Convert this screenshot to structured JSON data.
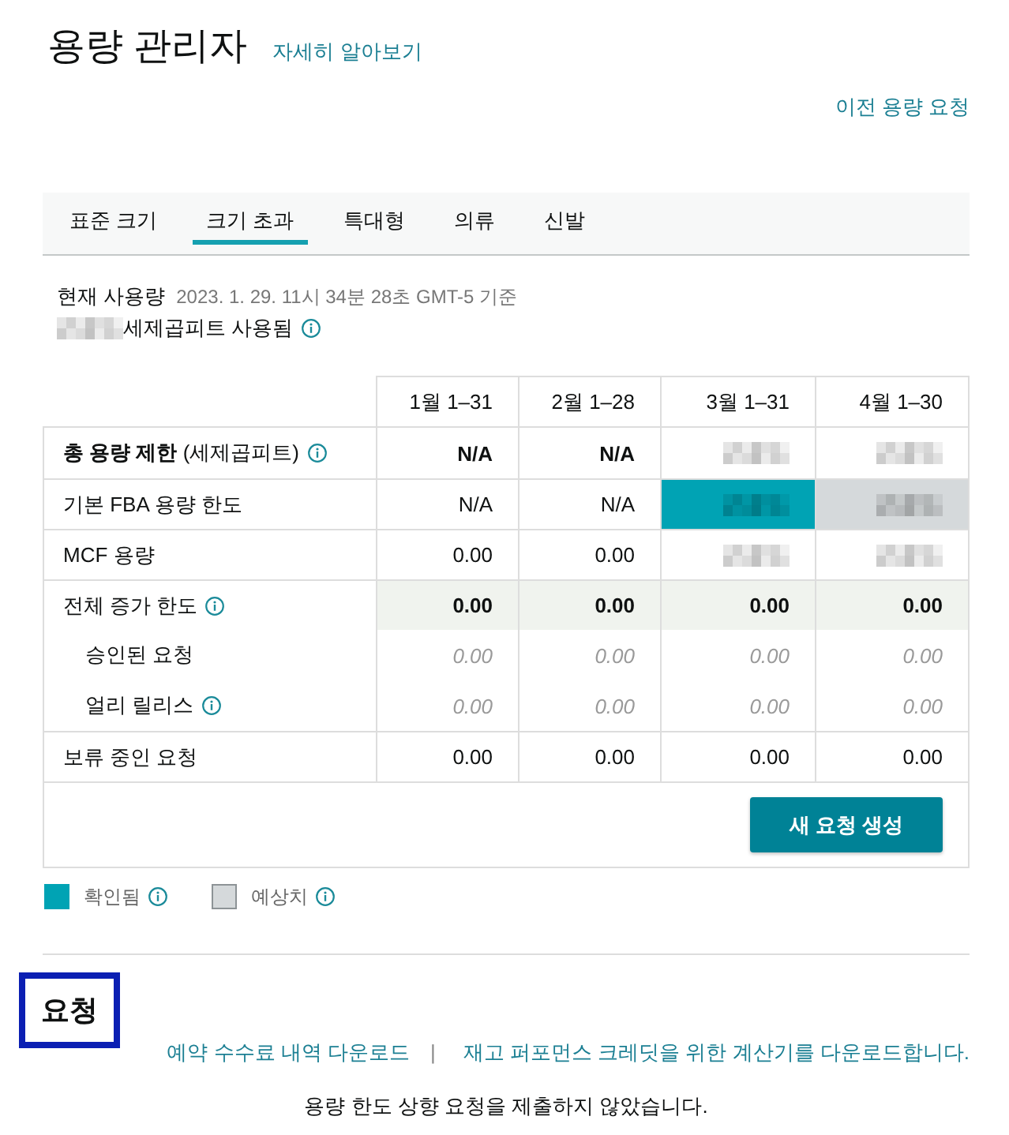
{
  "header": {
    "title": "용량 관리자",
    "learn_more_link": "자세히 알아보기",
    "previous_requests_link": "이전 용량 요청"
  },
  "tabs": [
    {
      "label": "표준 크기",
      "selected": false
    },
    {
      "label": "크기 초과",
      "selected": true
    },
    {
      "label": "특대형",
      "selected": false
    },
    {
      "label": "의류",
      "selected": false
    },
    {
      "label": "신발",
      "selected": false
    }
  ],
  "usage": {
    "label": "현재 사용량",
    "timestamp": "2023. 1. 29. 11시 34분 28초 GMT-5 기준",
    "amount_redacted": true,
    "unit": "세제곱피트 사용됨",
    "info": true
  },
  "table": {
    "columns": [
      "1월 1–31",
      "2월 1–28",
      "3월 1–31",
      "4월 1–30"
    ],
    "rows": [
      {
        "label": "**총 용량 제한** (세제곱피트)",
        "kind": "total",
        "info": true,
        "cells": [
          {
            "value": "N/A"
          },
          {
            "value": "N/A"
          },
          {
            "redacted": true
          },
          {
            "redacted": true
          }
        ]
      },
      {
        "label": "기본 FBA 용량 한도",
        "kind": "normal",
        "info": false,
        "cells": [
          {
            "value": "N/A"
          },
          {
            "value": "N/A"
          },
          {
            "redacted": true,
            "color": "#00a3b4"
          },
          {
            "redacted": true,
            "color": "#d5d9db"
          }
        ]
      },
      {
        "label": "MCF 용량",
        "kind": "normal",
        "info": false,
        "cells": [
          {
            "value": "0.00"
          },
          {
            "value": "0.00"
          },
          {
            "redacted": true
          },
          {
            "redacted": true
          }
        ]
      },
      {
        "label": "전체 증가 한도",
        "kind": "subtotal",
        "info": true,
        "cells": [
          {
            "value": "0.00"
          },
          {
            "value": "0.00"
          },
          {
            "value": "0.00"
          },
          {
            "value": "0.00"
          }
        ]
      },
      {
        "label": "승인된 요청",
        "kind": "sub",
        "info": false,
        "cells": [
          {
            "value": "0.00"
          },
          {
            "value": "0.00"
          },
          {
            "value": "0.00"
          },
          {
            "value": "0.00"
          }
        ]
      },
      {
        "label": "얼리 릴리스",
        "kind": "sub",
        "info": true,
        "cells": [
          {
            "value": "0.00"
          },
          {
            "value": "0.00"
          },
          {
            "value": "0.00"
          },
          {
            "value": "0.00"
          }
        ]
      },
      {
        "label": "보류 중인 요청",
        "kind": "normal",
        "info": false,
        "cells": [
          {
            "value": "0.00"
          },
          {
            "value": "0.00"
          },
          {
            "value": "0.00"
          },
          {
            "value": "0.00"
          }
        ]
      }
    ],
    "new_request_button": "새 요청 생성"
  },
  "legend": [
    {
      "label": "확인됨",
      "color": "#00a3b4",
      "info": true
    },
    {
      "label": "예상치",
      "color": "#d5d9db",
      "info": true
    }
  ],
  "requests": {
    "heading": "요청",
    "highlighted": true,
    "links": [
      "예약 수수료 내역 다운로드",
      "재고 퍼포먼스 크레딧을 위한 계산기를 다운로드합니다."
    ],
    "separator": "|",
    "message": "용량 한도 상향 요청을 제출하지 않았습니다."
  }
}
